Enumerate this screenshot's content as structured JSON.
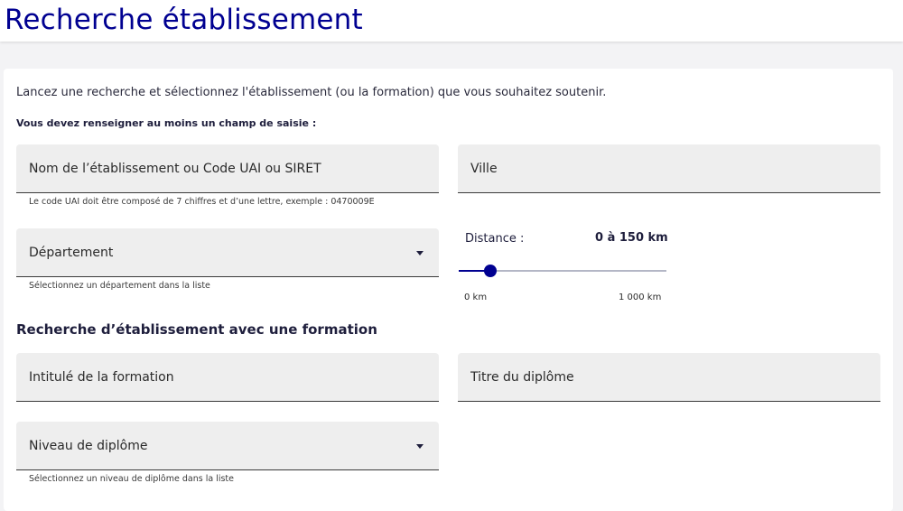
{
  "header": {
    "title": "Recherche établissement"
  },
  "form": {
    "intro": "Lancez une recherche et sélectionnez l'établissement (ou la formation) que vous souhaitez soutenir.",
    "required_note": "Vous devez renseigner au moins un champ de saisie :",
    "name_field": {
      "placeholder": "Nom de l’établissement ou Code UAI ou SIRET",
      "hint": "Le code UAI doit être composé de 7 chiffres et d’une lettre, exemple : 0470009E"
    },
    "city_field": {
      "placeholder": "Ville"
    },
    "department_select": {
      "value": "Département",
      "hint": "Sélectionnez un département dans la liste"
    },
    "distance": {
      "label": "Distance :",
      "value_text": "0 à 150 km",
      "min_label": "0 km",
      "max_label": "1 000 km",
      "min": 0,
      "max": 1000,
      "value": 150
    },
    "formation_section": {
      "title": "Recherche d’établissement avec une formation",
      "formation_field": {
        "placeholder": "Intitulé de la formation"
      },
      "diploma_title_field": {
        "placeholder": "Titre du diplôme"
      },
      "diploma_level_select": {
        "value": "Niveau de diplôme",
        "hint": "Sélectionnez un niveau de diplôme dans la liste"
      }
    }
  },
  "colors": {
    "brand_blue": "#000091",
    "field_bg": "#eeeeee",
    "page_bg": "#f3f3f5"
  }
}
